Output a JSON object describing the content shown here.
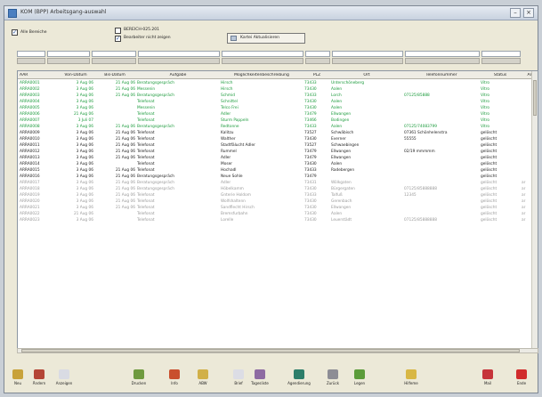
{
  "window": {
    "title": "KOM (BPP) Arbeitsgang-auswahl"
  },
  "filters": {
    "radio_all_label": "Alle Bereiche",
    "checkbox_pool_label": "BEREICH-025.201 ",
    "checkbox_pool_sub": "Bearbeiter nicht zeigen",
    "refresh_label": "Kartei Aktualisieren"
  },
  "table": {
    "columns": [
      "AAR",
      "Von-Datum",
      "Bis-Datum",
      "Aufgabe",
      "Möglichkeitenbeschreibung",
      "PLZ",
      "Ort",
      "Telefonnummer",
      "Status",
      "Ar"
    ],
    "rows": [
      {
        "color": "#1a9a3b",
        "cells": [
          "ARRA0001",
          "3 Aug 06",
          "21 Aug 06",
          "Beratungsgespräch",
          "Hirsch",
          "73433",
          "Unterschöneberg",
          "",
          "Vitro",
          ""
        ]
      },
      {
        "color": "#1a9a3b",
        "cells": [
          "ARRA0002",
          "3 Aug 06",
          "21 Aug 06",
          "Messenin",
          "Hirsch",
          "73430",
          "Aalen",
          "",
          "Vitro",
          ""
        ]
      },
      {
        "color": "#1a9a3b",
        "cells": [
          "ARRA0003",
          "3 Aug 06",
          "21 Aug 06",
          "Beratungsgespräch",
          "Schmid",
          "73433",
          "Lorch",
          "07125/85888",
          "Vitro",
          ""
        ]
      },
      {
        "color": "#1a9a3b",
        "cells": [
          "ARRA0004",
          "3 Aug 06",
          "",
          "Telefonat",
          "Schnittel",
          "73430",
          "Aalen",
          "",
          "Vitro",
          ""
        ]
      },
      {
        "color": "#1a9a3b",
        "cells": [
          "ARRA0005",
          "3 Aug 06",
          "",
          "Messenin",
          "Telco Frei",
          "73430",
          "Aalen",
          "",
          "Vitro",
          ""
        ]
      },
      {
        "color": "#1a9a3b",
        "cells": [
          "ARRA0006",
          "21 Aug 06",
          "",
          "Telefonat",
          "Adler",
          "73479",
          "Ellwangen",
          "",
          "Vitro",
          ""
        ]
      },
      {
        "color": "#1a9a3b",
        "cells": [
          "ARRA0007",
          "3 Juli 07",
          "",
          "Telefonat",
          "Sturm Pappeln",
          "73466",
          "Bodingen",
          "",
          "Vitro",
          ""
        ]
      },
      {
        "color": "#1a9a3b",
        "cells": [
          "ARRA0008",
          "3 Aug 06",
          "21 Aug 06",
          "Beratungsgespräch",
          "Redtonne",
          "73433",
          "Aalen",
          "07125/74083799",
          "Vitro",
          ""
        ]
      },
      {
        "color": "#222222",
        "cells": [
          "ARRA0009",
          "3 Aug 06",
          "21 Aug 06",
          "Telefonat",
          "Kalitzu",
          "73527",
          "Schwäbisch",
          "07361 Schönhelenstra",
          "gelöscht",
          ""
        ]
      },
      {
        "color": "#222222",
        "cells": [
          "ARRA0010",
          "3 Aug 06",
          "21 Aug 06",
          "Telefonat",
          "Walther",
          "73430",
          "Everner",
          "55555",
          "gelöscht",
          ""
        ]
      },
      {
        "color": "#222222",
        "cells": [
          "ARRA0011",
          "3 Aug 06",
          "21 Aug 06",
          "Telefonat",
          "Stadtfälucht Adler",
          "73527",
          "Schwaebingen",
          "",
          "gelöscht",
          ""
        ]
      },
      {
        "color": "#222222",
        "cells": [
          "ARRA0012",
          "3 Aug 06",
          "21 Aug 06",
          "Telefonat",
          "Rummel",
          "73479",
          "Ellwangen",
          "02/19 mmmmm",
          "gelöscht",
          ""
        ]
      },
      {
        "color": "#222222",
        "cells": [
          "ARRA0013",
          "3 Aug 06",
          "21 Aug 06",
          "Telefonat",
          "Adler",
          "73479",
          "Ellwangen",
          "",
          "gelöscht",
          ""
        ]
      },
      {
        "color": "#222222",
        "cells": [
          "ARRA0014",
          "3 Aug 06",
          "",
          "Telefonat",
          "Moser",
          "73430",
          "Aalen",
          "",
          "gelöscht",
          ""
        ]
      },
      {
        "color": "#222222",
        "cells": [
          "ARRA0015",
          "3 Aug 06",
          "21 Aug 06",
          "Telefonat",
          "Hochadl",
          "73433",
          "Radebergen",
          "",
          "gelöscht",
          ""
        ]
      },
      {
        "color": "#222222",
        "cells": [
          "ARRA0016",
          "3 Aug 06",
          "21 Aug 06",
          "Beratungsgespräch",
          "Neue Sohle",
          "73479",
          "",
          "",
          "gelöscht",
          ""
        ]
      },
      {
        "color": "#9a9a9a",
        "cells": [
          "ARRA0017",
          "3 Aug 06",
          "21 Aug 06",
          "Beratungsgespräch",
          "Adler",
          "73431",
          "Wölkgaten",
          "",
          "gelöscht",
          "ar"
        ]
      },
      {
        "color": "#9a9a9a",
        "cells": [
          "ARRA0018",
          "3 Aug 06",
          "21 Aug 06",
          "Beratungsgespräch",
          "Höbelkamm",
          "73430",
          "Bürgergaten",
          "07125/85888888",
          "gelöscht",
          "ar"
        ]
      },
      {
        "color": "#9a9a9a",
        "cells": [
          "ARRA0019",
          "3 Aug 06",
          "21 Aug 06",
          "Telefonat",
          "Gnterie Holdom",
          "73433",
          "Talfuß",
          "12345",
          "gelöscht",
          "ar"
        ]
      },
      {
        "color": "#9a9a9a",
        "cells": [
          "ARRA0020",
          "3 Aug 06",
          "21 Aug 06",
          "Telefonat",
          "Wolfshaltenn",
          "73430",
          "Gerenbach",
          "",
          "gelöscht",
          "ar"
        ]
      },
      {
        "color": "#9a9a9a",
        "cells": [
          "ARRA0021",
          "3 Aug 06",
          "21 Aug 06",
          "Telefonat",
          "Sandflecht Hirsch",
          "73430",
          "Ellwangen",
          "",
          "gelöscht",
          "ar"
        ]
      },
      {
        "color": "#9a9a9a",
        "cells": [
          "ARRA0022",
          "21 Aug 06",
          "",
          "Telefonat",
          "Bremsfurbahn",
          "73430",
          "Aalen",
          "",
          "gelöscht",
          "ar"
        ]
      },
      {
        "color": "#9a9a9a",
        "cells": [
          "ARRA0023",
          "3 Aug 06",
          "",
          "Telefonat",
          "Lorelle",
          "73430",
          "Leuerstädt",
          "07125/85888888",
          "gelöscht",
          "ar"
        ]
      }
    ]
  },
  "toolbar": {
    "buttons": [
      {
        "label": "Neu",
        "color": "#c8a23a"
      },
      {
        "label": "Ändern",
        "color": "#b44536"
      },
      {
        "label": "Anzeigen",
        "color": "#d9dbe3"
      },
      {
        "label": "Drucken",
        "color": "#6f9a3f"
      },
      {
        "label": "Info",
        "color": "#c94f2d"
      },
      {
        "label": "ABW",
        "color": "#d1b048"
      },
      {
        "label": "Brief",
        "color": "#dcdde5"
      },
      {
        "label": "Tagesliste",
        "color": "#8e6ba2"
      },
      {
        "label": "Agendierung",
        "color": "#2d7e6a"
      },
      {
        "label": "Zurück",
        "color": "#8d8d95"
      },
      {
        "label": "Legen",
        "color": "#5c9c3a"
      },
      {
        "label": "Hilfeme",
        "color": "#d8b744"
      },
      {
        "label": "Mail",
        "color": "#c6343a"
      },
      {
        "label": "Ende",
        "color": "#d12c2c"
      }
    ]
  }
}
